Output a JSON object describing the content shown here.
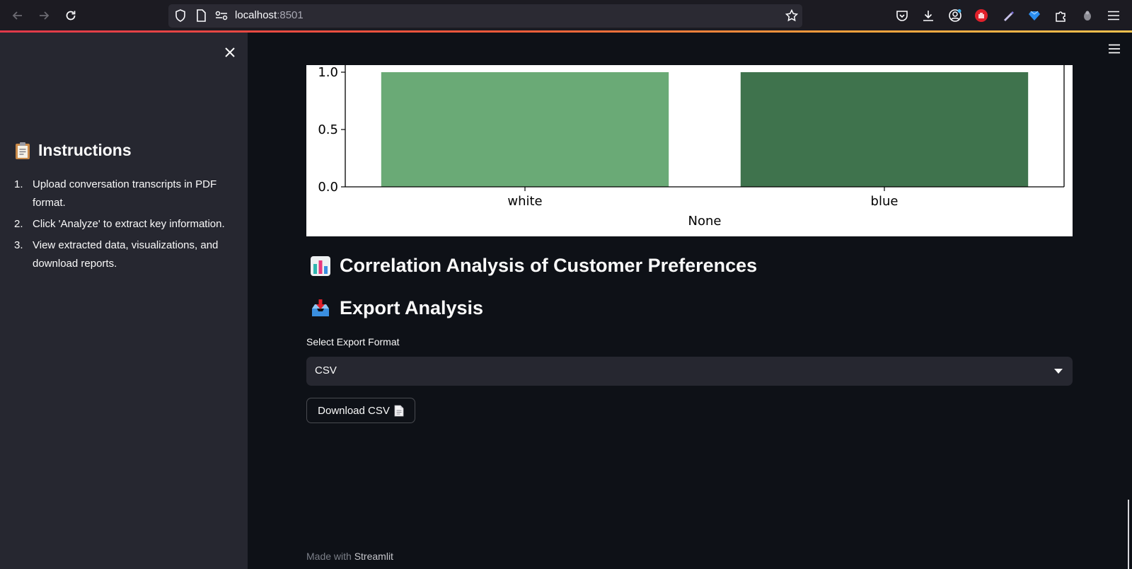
{
  "browser": {
    "url_host": "localhost",
    "url_port": ":8501"
  },
  "sidebar": {
    "title": "Instructions",
    "title_emoji": "clipboard-icon",
    "steps": [
      {
        "num": "1.",
        "text": "Upload conversation transcripts in PDF format."
      },
      {
        "num": "2.",
        "text": "Click 'Analyze' to extract key information."
      },
      {
        "num": "3.",
        "text": "View extracted data, visualizations, and download reports."
      }
    ]
  },
  "chart_data": {
    "type": "bar",
    "categories": [
      "white",
      "blue"
    ],
    "values": [
      1.0,
      1.0
    ],
    "colors": [
      "#6aaa76",
      "#3f734d"
    ],
    "xlabel": "None",
    "ylabel": "",
    "yticks": [
      "0.0",
      "0.5",
      "1.0"
    ],
    "ylim": [
      0,
      1.05
    ]
  },
  "sections": {
    "correlation_title": "Correlation Analysis of Customer Preferences",
    "export_title": "Export Analysis"
  },
  "export": {
    "select_label": "Select Export Format",
    "selected_value": "CSV",
    "download_label": "Download CSV"
  },
  "footer": {
    "prefix": "Made with ",
    "brand": "Streamlit"
  },
  "colors": {
    "app_bg": "#0e1117",
    "sidebar_bg": "#262730",
    "browser_bg": "#1c1b22",
    "text": "#fafafa"
  }
}
